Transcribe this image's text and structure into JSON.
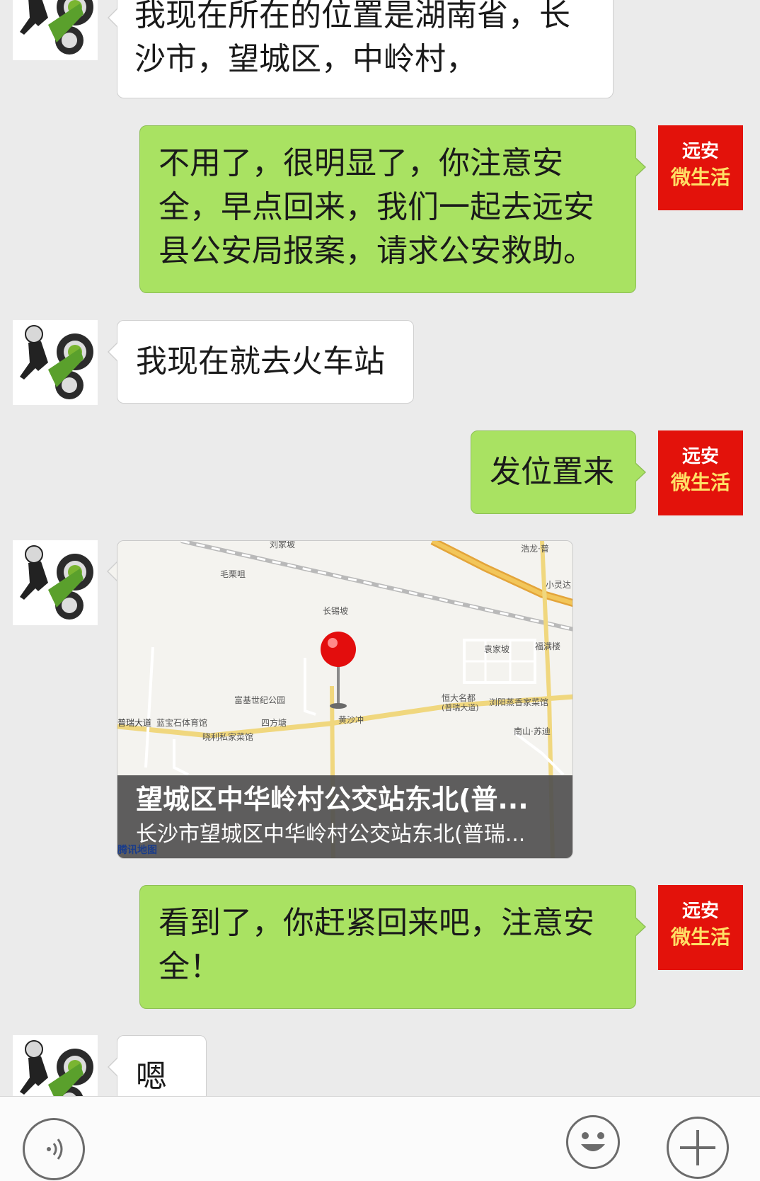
{
  "messages": [
    {
      "side": "left",
      "text_lines": [
        "我现在所在的位置是湖南省，长",
        "沙市，望城区，中岭村，"
      ]
    },
    {
      "side": "right",
      "text_lines": [
        "不用了，很明显了，你注意安",
        "全，早点回来，我们一起去远安",
        "县公安局报案，请求公安救助。"
      ]
    },
    {
      "side": "left",
      "text_lines": [
        "我现在就去火车站"
      ]
    },
    {
      "side": "right",
      "text_lines": [
        "发位置来"
      ]
    },
    {
      "side": "left",
      "type": "location"
    },
    {
      "side": "right",
      "text_lines": [
        "看到了，你赶紧回来吧，注意安",
        "全！"
      ]
    },
    {
      "side": "left",
      "text_lines": [
        "嗯"
      ]
    }
  ],
  "brand_avatar": {
    "line1": "远安",
    "line2": "微生活"
  },
  "location": {
    "title": "望城区中华岭村公交站东北(普...",
    "address": "长沙市望城区中华岭村公交站东北(普瑞...",
    "map_brand": "腾讯地图",
    "map_labels": {
      "liujiapo": "刘家坡",
      "haolong": "浩龙·普",
      "xiaolingdian": "小灵达",
      "maolitu": "毛栗咀",
      "changxipo": "长锡坡",
      "yuanjiapo": "袁家坡",
      "fumanlou": "福满楼",
      "fujishiji": "富基世纪公园",
      "hengda": "恒大名都",
      "hengda_sub": "(普瑞大道)",
      "liuyang": "浏阳蒸香家菜馆",
      "puruidadao": "普瑞大道",
      "lanbaoshi": "蓝宝石体育馆",
      "sifangtang": "四方塘",
      "huangshachong": "黄沙冲",
      "xiaoli": "晓利私家菜馆",
      "nanshan": "南山·苏迪"
    }
  },
  "toolbar": {
    "voice_icon": "voice-wave-icon",
    "emoji_icon": "smiley-icon",
    "plus_icon": "plus-icon"
  },
  "colors": {
    "background": "#ebebeb",
    "right_bubble": "#a9e262",
    "left_bubble": "#ffffff",
    "brand_red": "#e3120b",
    "map_pin": "#e30d0d"
  }
}
